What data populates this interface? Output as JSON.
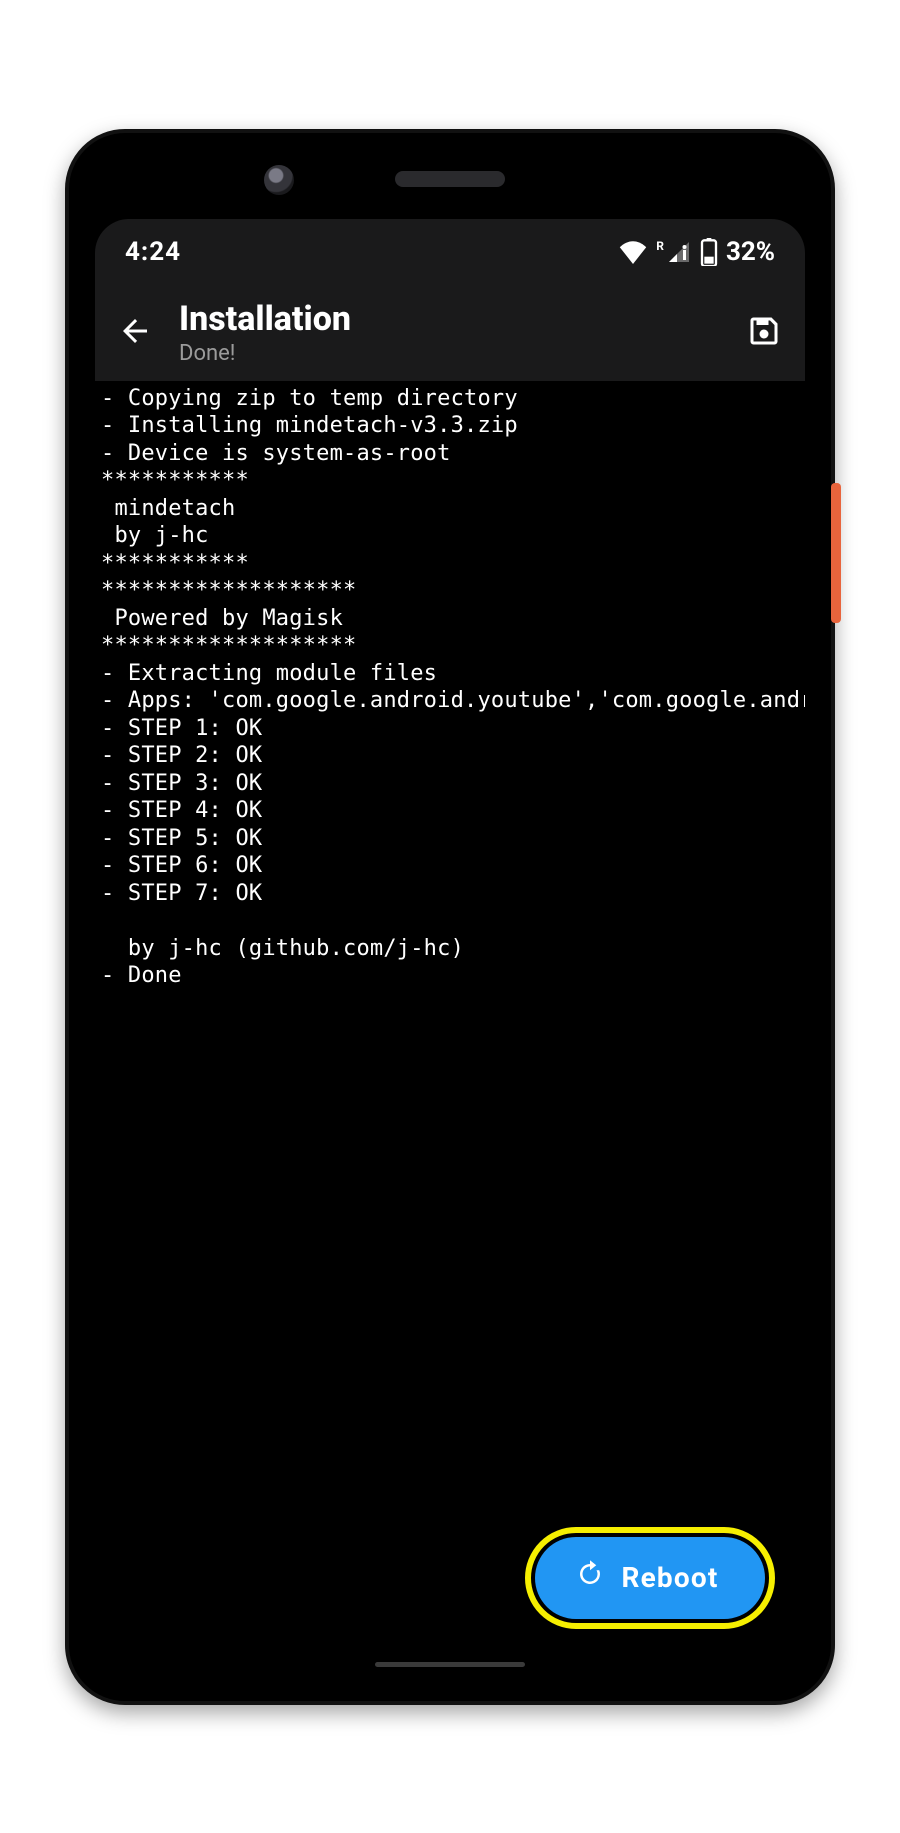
{
  "statusbar": {
    "time": "4:24",
    "roam_label": "R",
    "battery_text": "32%"
  },
  "appbar": {
    "title": "Installation",
    "subtitle": "Done!"
  },
  "console_text": "- Copying zip to temp directory\n- Installing mindetach-v3.3.zip\n- Device is system-as-root\n***********\n mindetach\n by j-hc\n***********\n*******************\n Powered by Magisk\n*******************\n- Extracting module files\n- Apps: 'com.google.android.youtube','com.google.andro\n- STEP 1: OK\n- STEP 2: OK\n- STEP 3: OK\n- STEP 4: OK\n- STEP 5: OK\n- STEP 6: OK\n- STEP 7: OK\n\n  by j-hc (github.com/j-hc)\n- Done",
  "fab": {
    "label": "Reboot"
  }
}
